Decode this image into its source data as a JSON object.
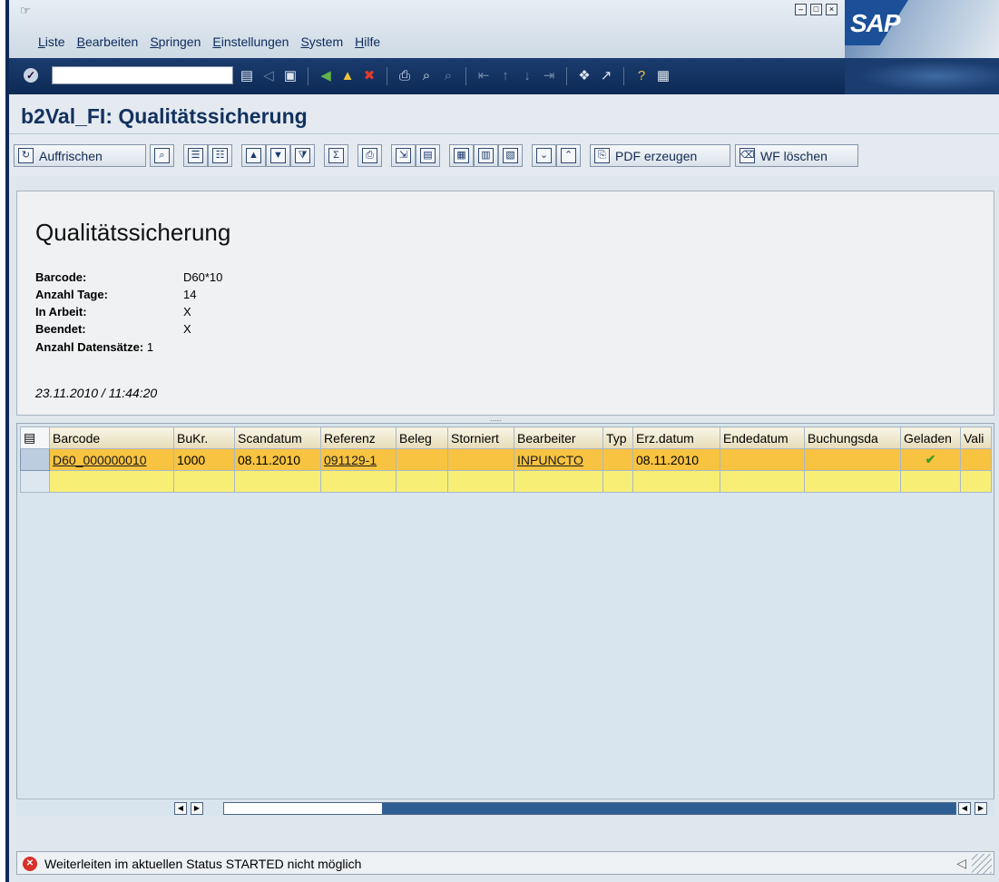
{
  "menubar": {
    "items": [
      "Liste",
      "Bearbeiten",
      "Springen",
      "Einstellungen",
      "System",
      "Hilfe"
    ],
    "logo": "SAP"
  },
  "title": "b2Val_FI: Qualitätssicherung",
  "toolbar": {
    "refresh_label": "Auffrischen",
    "pdf_label": "PDF erzeugen",
    "wf_delete_label": "WF löschen"
  },
  "header": {
    "heading": "Qualitätssicherung",
    "fields": [
      {
        "label": "Barcode:",
        "value": "D60*10"
      },
      {
        "label": "Anzahl Tage:",
        "value": "14"
      },
      {
        "label": "In Arbeit:",
        "value": "X"
      },
      {
        "label": "Beendet:",
        "value": "X"
      },
      {
        "label": "Anzahl Datensätze:",
        "value": "1"
      }
    ],
    "timestamp": "23.11.2010 / 11:44:20"
  },
  "grid": {
    "columns": [
      "Barcode",
      "BuKr.",
      "Scandatum",
      "Referenz",
      "Beleg",
      "Storniert",
      "Bearbeiter",
      "Typ",
      "Erz.datum",
      "Endedatum",
      "Buchungsda",
      "Geladen",
      "Vali"
    ],
    "rows": [
      {
        "barcode": "D60_000000010",
        "bukr": "1000",
        "scandatum": "08.11.2010",
        "referenz": "091129-1",
        "beleg": "",
        "storniert": "",
        "bearbeiter": "INPUNCTO",
        "typ": "",
        "erzdatum": "08.11.2010",
        "endedatum": "",
        "buchungsda": "",
        "geladen": "✔",
        "vali": ""
      }
    ]
  },
  "status": {
    "message": "Weiterleiten im aktuellen Status STARTED nicht möglich",
    "type": "error"
  },
  "colors": {
    "row_selected": "#f8c341",
    "row_empty": "#f7ee76",
    "title_text": "#12315f"
  }
}
